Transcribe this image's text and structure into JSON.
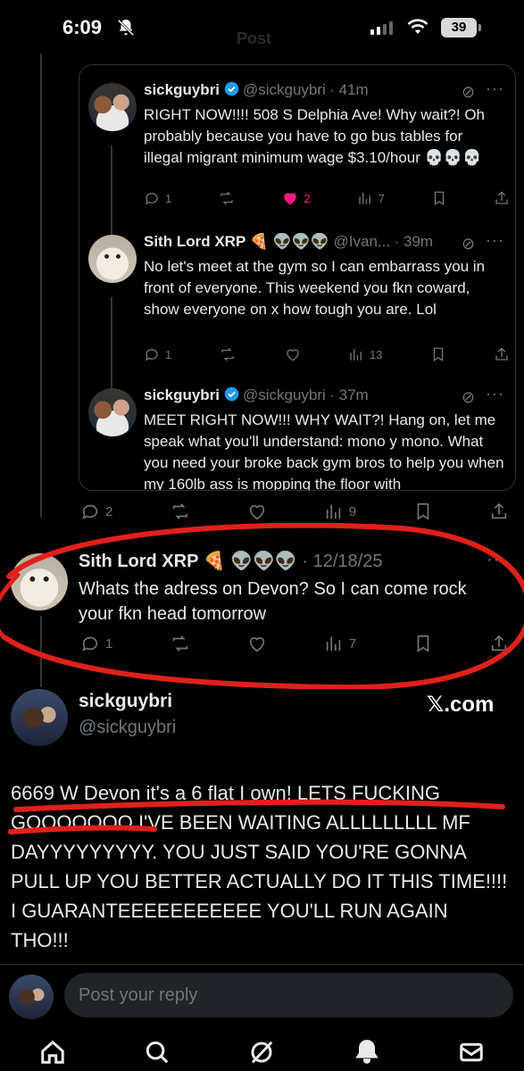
{
  "status_bar": {
    "time": "6:09",
    "battery": "39",
    "ghost_title": "Post"
  },
  "quoted_thread": [
    {
      "name": "sickguybri",
      "handle": "@sickguybri",
      "time": "· 41m",
      "text": "RIGHT NOW!!!! 508 S Delphia Ave! Why wait?! Oh probably because you have to go bus tables for illegal migrant minimum wage $3.10/hour 💀💀💀",
      "replies": "1",
      "retweets": "",
      "likes": "2",
      "views": "7"
    },
    {
      "name": "Sith Lord XRP 🍕 👽👽👽",
      "handle": "@Ivan...",
      "time": "· 39m",
      "text": "No let's meet at the gym so I can embarrass you in front of everyone. This weekend you fkn coward, show everyone on x how tough you are. Lol",
      "replies": "1",
      "retweets": "",
      "likes": "",
      "views": "13"
    },
    {
      "name": "sickguybri",
      "handle": "@sickguybri",
      "time": "· 37m",
      "text": "MEET RIGHT NOW!!! WHY WAIT?! Hang on, let me speak what you'll understand: mono y mono. What you need your broke back gym bros to help you when my 160lb ass is mopping the floor with"
    }
  ],
  "outer_actions": {
    "replies": "2",
    "retweets": "",
    "likes": "",
    "views": "9"
  },
  "reply_tweet": {
    "name": "Sith Lord XRP 🍕 👽👽👽",
    "date": "· 12/18/25",
    "text": "Whats the adress on Devon? So I can come rock your fkn head tomorrow",
    "replies": "1",
    "retweets": "",
    "likes": "",
    "views": "7"
  },
  "main_tweet": {
    "name": "sickguybri",
    "handle": "@sickguybri",
    "watermark": "𝕏.com",
    "text": "6669 W Devon it's a 6 flat I own! LETS FUCKING GOOOOOOO I'VE BEEN WAITING ALLLLLLLLL MF DAYYYYYYYYY. YOU JUST SAID YOU'RE GONNA PULL UP YOU BETTER ACTUALLY DO IT THIS TIME!!!! I GUARANTEEEEEEEEEEE YOU'LL RUN AGAIN THO!!!"
  },
  "reply_box": {
    "placeholder": "Post your reply"
  },
  "colors": {
    "accent_like": "#f91880",
    "verified": "#1d9bf0",
    "annotation": "#e0201b"
  },
  "nav_icons": [
    "home-icon",
    "search-icon",
    "grok-icon",
    "notifications-icon",
    "messages-icon"
  ]
}
